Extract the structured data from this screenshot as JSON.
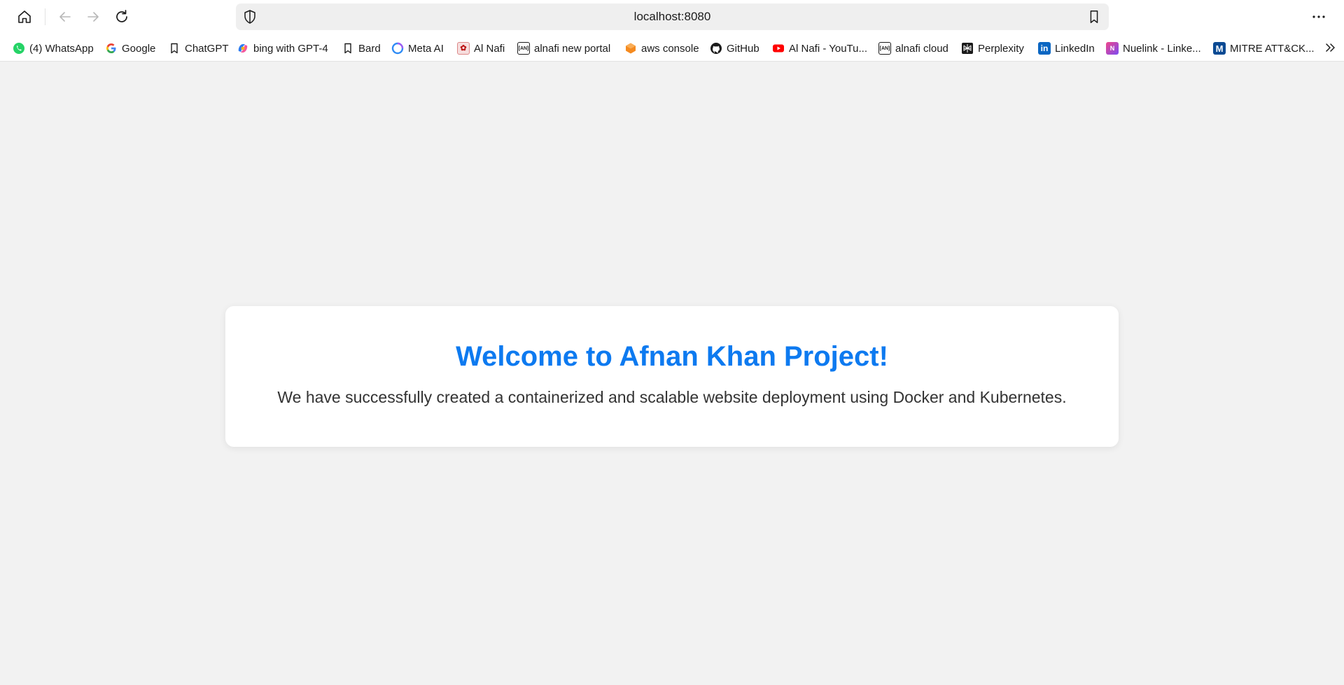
{
  "browser": {
    "address": "localhost:8080",
    "bookmarks": [
      {
        "label": "(4) WhatsApp",
        "icon": "whatsapp-icon"
      },
      {
        "label": "Google",
        "icon": "google-icon"
      },
      {
        "label": "ChatGPT",
        "icon": "bookmark-icon"
      },
      {
        "label": "bing with GPT-4",
        "icon": "copilot-icon"
      },
      {
        "label": "Bard",
        "icon": "bookmark-icon"
      },
      {
        "label": "Meta AI",
        "icon": "meta-ai-icon"
      },
      {
        "label": "Al Nafi",
        "icon": "alnafi-icon"
      },
      {
        "label": "alnafi new portal",
        "icon": "alnafi-portal-icon"
      },
      {
        "label": "aws console",
        "icon": "aws-icon"
      },
      {
        "label": "GitHub",
        "icon": "github-icon"
      },
      {
        "label": "Al Nafi - YouTu...",
        "icon": "youtube-icon"
      },
      {
        "label": "alnafi cloud",
        "icon": "alnafi-cloud-icon"
      },
      {
        "label": "Perplexity",
        "icon": "perplexity-icon"
      },
      {
        "label": "LinkedIn",
        "icon": "linkedin-icon"
      },
      {
        "label": "Nuelink - Linke...",
        "icon": "nuelink-icon"
      },
      {
        "label": "MITRE ATT&CK...",
        "icon": "mitre-icon"
      }
    ]
  },
  "page": {
    "heading": "Welcome to Afnan Khan Project!",
    "message": "We have successfully created a containerized and scalable website deployment using Docker and Kubernetes."
  },
  "colors": {
    "heading": "#0d7af0",
    "background": "#f2f2f2"
  }
}
